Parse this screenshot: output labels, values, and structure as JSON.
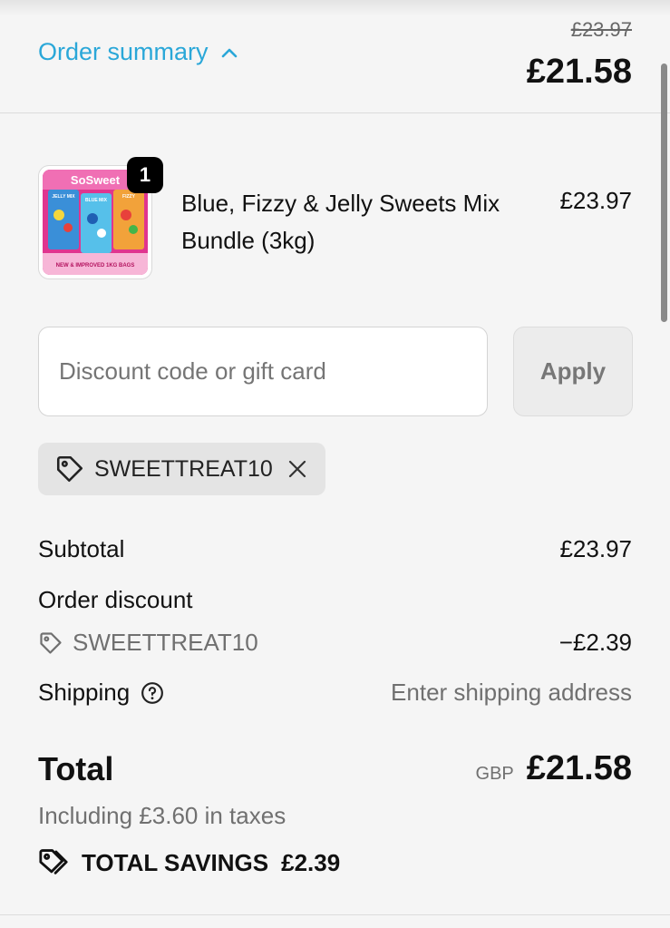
{
  "header": {
    "toggle_label": "Order summary",
    "compare_at_total": "£23.97",
    "total": "£21.58"
  },
  "product": {
    "quantity": "1",
    "name": "Blue, Fizzy & Jelly Sweets Mix Bundle (3kg)",
    "price": "£23.97",
    "image": {
      "brand_text": "SoSweet",
      "labels": [
        "JELLY MIX",
        "BLUE MIX",
        "FIZZY"
      ],
      "banner_text": "NEW & IMPROVED 1KG BAGS"
    }
  },
  "discount": {
    "placeholder": "Discount code or gift card",
    "apply_label": "Apply",
    "applied_code": "SWEETTREAT10"
  },
  "summary": {
    "subtotal_label": "Subtotal",
    "subtotal_value": "£23.97",
    "order_discount_label": "Order discount",
    "discount_code": "SWEETTREAT10",
    "discount_value": "−£2.39",
    "shipping_label": "Shipping",
    "shipping_value": "Enter shipping address"
  },
  "total": {
    "label": "Total",
    "currency": "GBP",
    "amount": "£21.58",
    "taxes_note": "Including £3.60 in taxes",
    "savings_label": "TOTAL SAVINGS",
    "savings_amount": "£2.39"
  },
  "colors": {
    "accent": "#2aa7d8",
    "background": "#f5f5f5",
    "badge": "#000000"
  }
}
